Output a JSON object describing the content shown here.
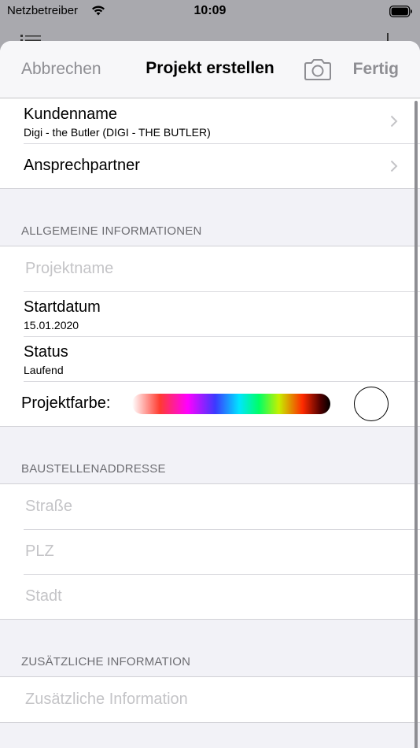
{
  "status_bar": {
    "carrier": "Netzbetreiber",
    "time": "10:09"
  },
  "nav": {
    "cancel_label": "Abbrechen",
    "title": "Projekt erstellen",
    "done_label": "Fertig",
    "camera_icon": "camera-icon"
  },
  "customer": {
    "name_title": "Kundenname",
    "name_value": "Digi - the Butler (DIGI - THE BUTLER)",
    "contact_title": "Ansprechpartner"
  },
  "general": {
    "header": "ALLGEMEINE INFORMATIONEN",
    "project_name_placeholder": "Projektname",
    "start_date_title": "Startdatum",
    "start_date_value": "15.01.2020",
    "status_title": "Status",
    "status_value": "Laufend",
    "color_label": "Projektfarbe:",
    "selected_color": "#ffffff"
  },
  "site_address": {
    "header": "BAUSTELLENADDRESSE",
    "street_placeholder": "Straße",
    "zip_placeholder": "PLZ",
    "city_placeholder": "Stadt"
  },
  "additional": {
    "header": "ZUSÄTZLICHE INFORMATION",
    "info_placeholder": "Zusätzliche Information"
  },
  "colors": {
    "muted_text": "#8e8e93",
    "placeholder": "#c4c4c7",
    "group_background": "#f2f2f7"
  }
}
